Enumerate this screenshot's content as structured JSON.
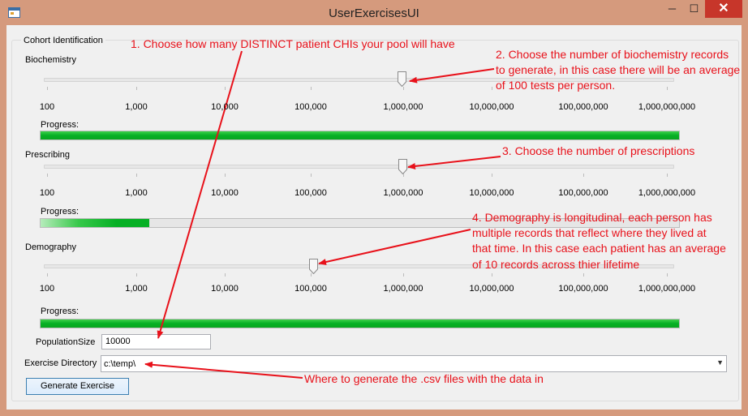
{
  "window": {
    "title": "UserExercisesUI",
    "minimize_glyph": "─",
    "maximize_glyph": "☐",
    "close_glyph": "✕",
    "app_icon": "window-form-icon"
  },
  "group": {
    "title": "Cohort Identification"
  },
  "ticks": [
    "100",
    "1,000",
    "10,000",
    "100,000",
    "1,000,000",
    "10,000,000",
    "100,000,000",
    "1,000,000,000"
  ],
  "biochemistry": {
    "label": "Biochemistry",
    "progress_label": "Progress:",
    "slider_value": "1,000,000",
    "progress_percent": 100
  },
  "prescribing": {
    "label": "Prescribing",
    "progress_label": "Progress:",
    "slider_value": "1,000,000",
    "progress_percent": 17
  },
  "demography": {
    "label": "Demography",
    "progress_label": "Progress:",
    "slider_value": "100,000",
    "progress_percent": 100
  },
  "population": {
    "label": "PopulationSize",
    "value": "10000"
  },
  "directory": {
    "label": "Exercise Directory",
    "value": "c:\\temp\\"
  },
  "generate_button": "Generate Exercise",
  "annotations": {
    "a1": "1. Choose how many DISTINCT patient CHIs your pool will have",
    "a2_line1": "2. Choose the number of biochemistry records",
    "a2_line2": "to generate, in this case there will be an average",
    "a2_line3": "of 100 tests per person.",
    "a3": "3. Choose the number of prescriptions",
    "a4_line1": "4. Demography is longitudinal, each person has",
    "a4_line2": "multiple records that reflect where they lived at",
    "a4_line3": "that time.  In this case each patient has an average",
    "a4_line4": "of 10 records across thier lifetime",
    "a5": "Where to generate the .csv files with the data in"
  },
  "colors": {
    "progress": "#06b025",
    "annotation": "#e8111a",
    "title_bar": "#d59a7d",
    "close": "#c7362a"
  }
}
